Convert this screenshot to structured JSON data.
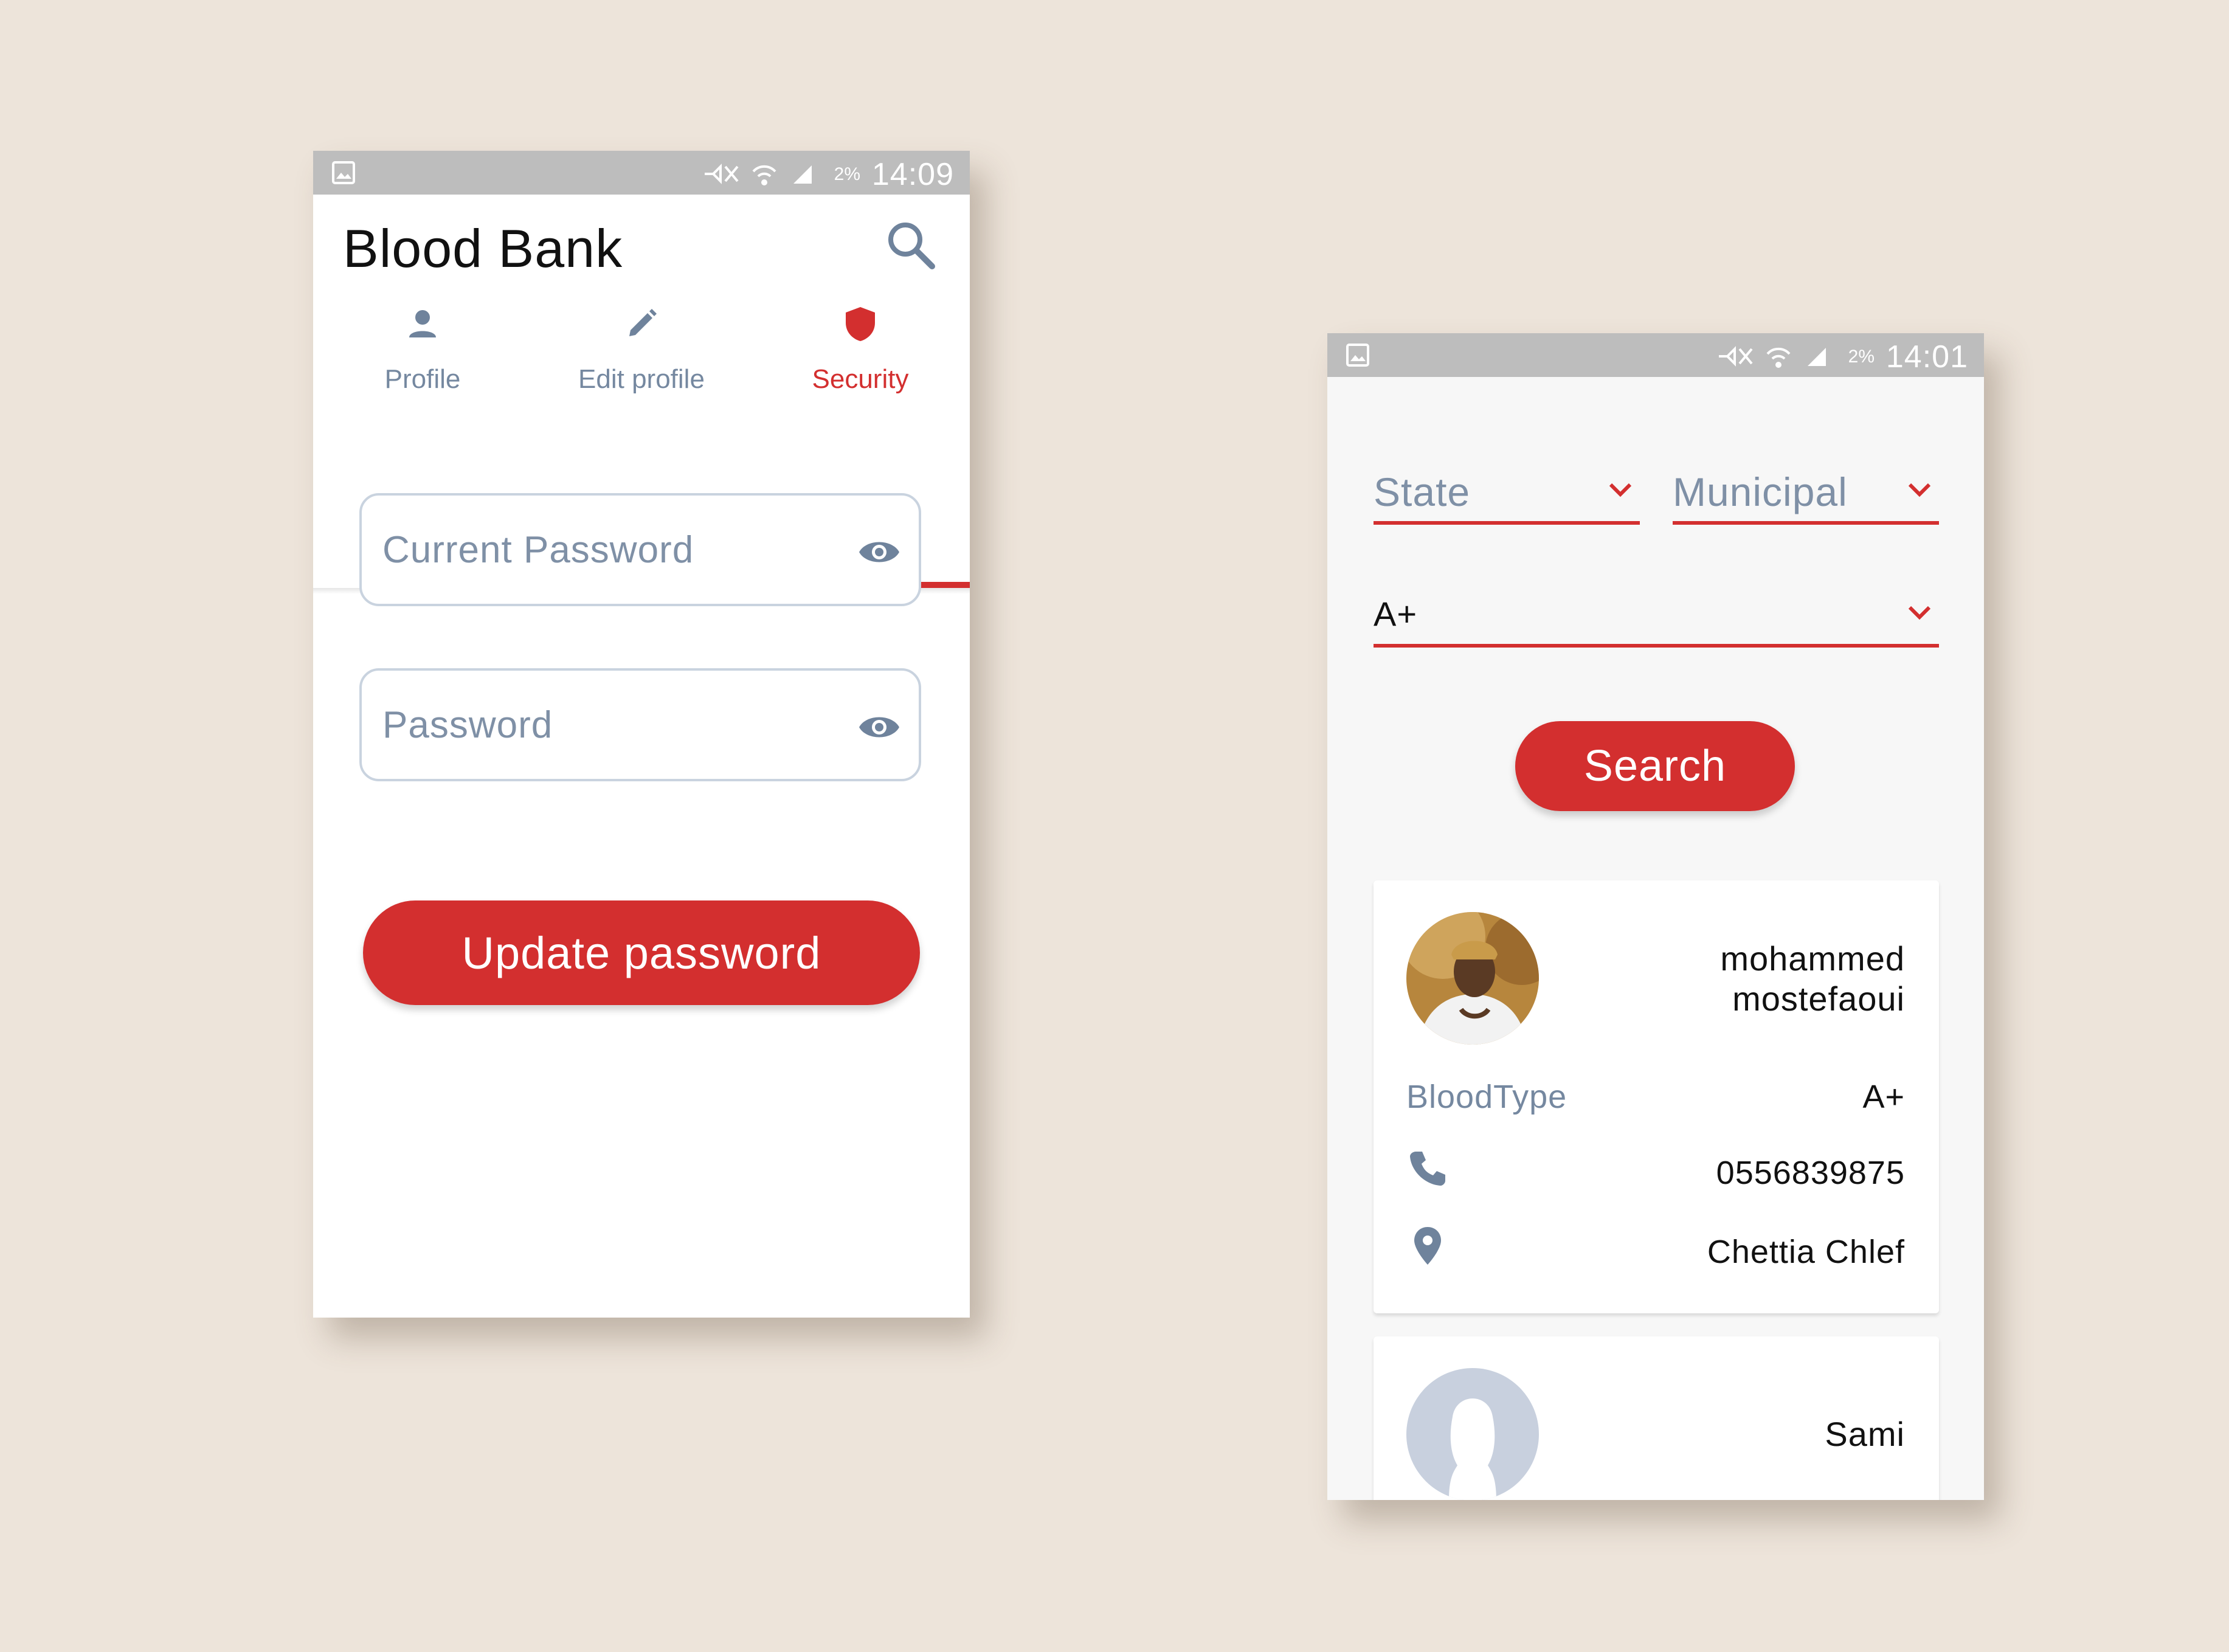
{
  "left_screen": {
    "status_bar": {
      "time": "14:09",
      "battery": "2%"
    },
    "app_title": "Blood Bank",
    "tabs": [
      {
        "label": "Profile",
        "icon": "person-icon",
        "active": false
      },
      {
        "label": "Edit profile",
        "icon": "pencil-icon",
        "active": false
      },
      {
        "label": "Security",
        "icon": "shield-icon",
        "active": true
      }
    ],
    "fields": {
      "current_password": {
        "placeholder": "Current Password",
        "value": ""
      },
      "password": {
        "placeholder": "Password",
        "value": ""
      }
    },
    "update_button": "Update password"
  },
  "right_screen": {
    "status_bar": {
      "time": "14:01",
      "battery": "2%"
    },
    "filters": {
      "state": "State",
      "municipal": "Municipal",
      "blood_type": "A+"
    },
    "search_button": "Search",
    "donors": [
      {
        "name": "mohammed mostefaoui",
        "blood_type_label": "BloodType",
        "blood_type": "A+",
        "phone": "0556839875",
        "location": "Chettia Chlef"
      },
      {
        "name": "Sami"
      }
    ]
  },
  "colors": {
    "accent": "#d32f2f",
    "background": "#ede4da",
    "muted_text": "#7588a0",
    "status_bar": "#bdbdbd"
  }
}
